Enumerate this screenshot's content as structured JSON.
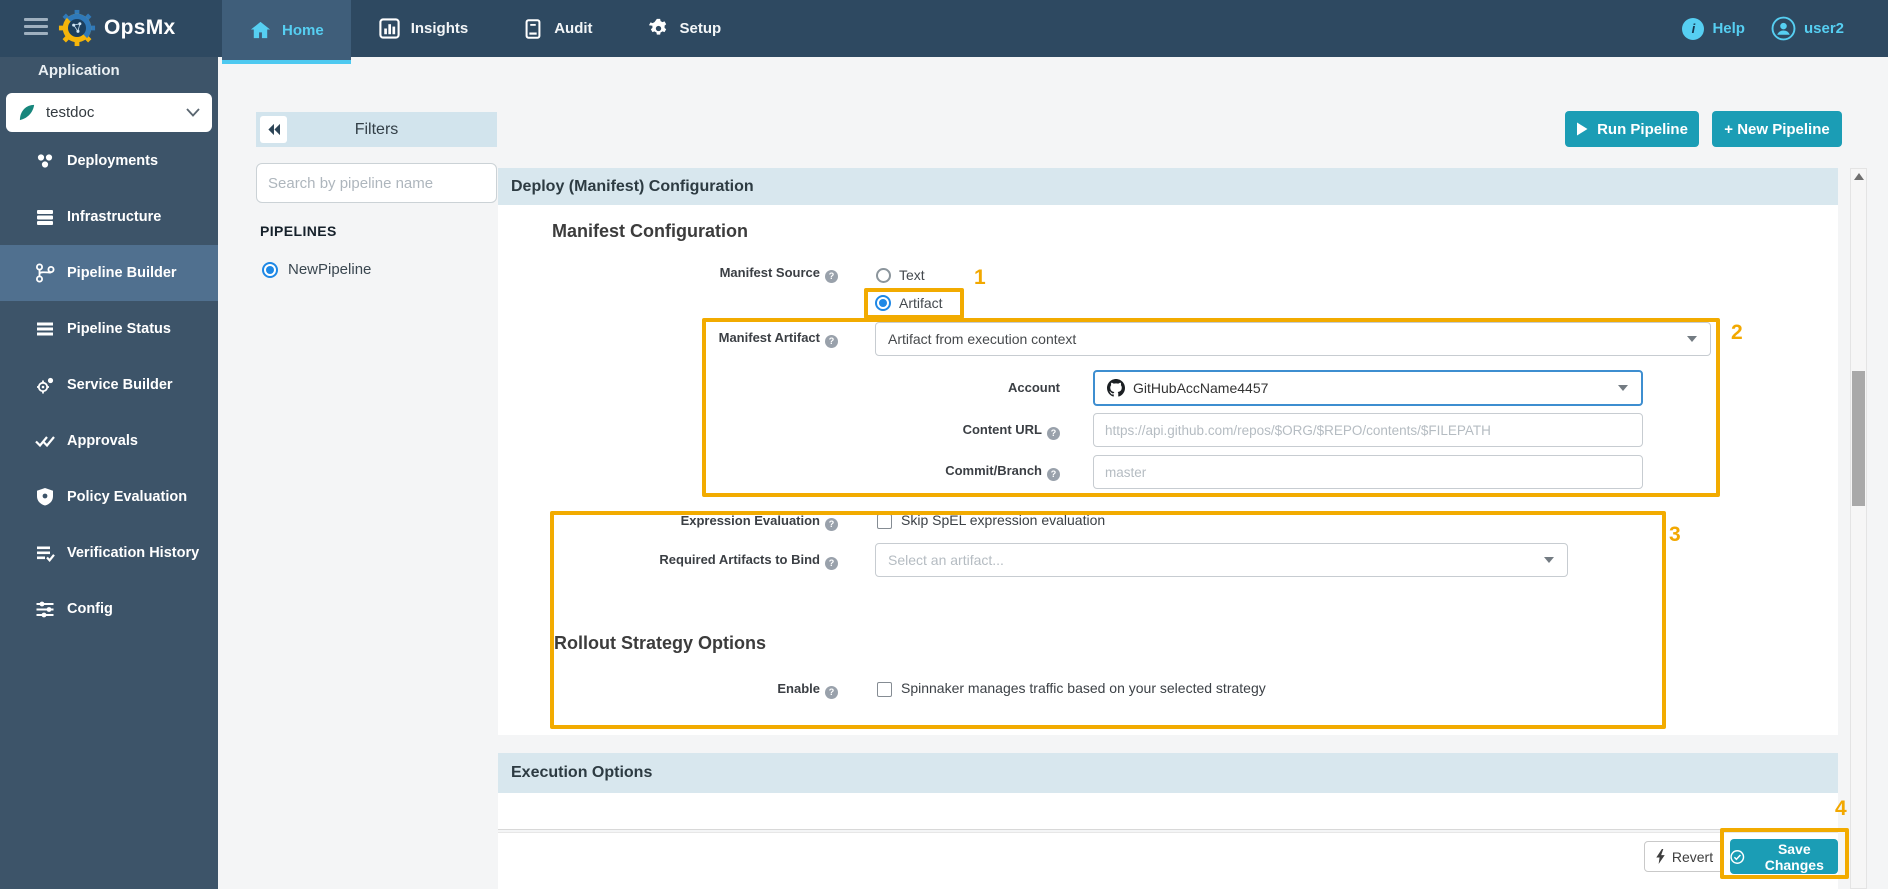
{
  "topbar": {
    "brand": "OpsMx",
    "tabs": [
      {
        "label": "Home",
        "active": true
      },
      {
        "label": "Insights",
        "active": false
      },
      {
        "label": "Audit",
        "active": false
      },
      {
        "label": "Setup",
        "active": false
      }
    ],
    "help_label": "Help",
    "user_label": "user2"
  },
  "sidebar": {
    "section_label": "Application",
    "selected_app": "testdoc",
    "items": [
      {
        "label": "Deployments"
      },
      {
        "label": "Infrastructure"
      },
      {
        "label": "Pipeline Builder",
        "active": true
      },
      {
        "label": "Pipeline Status"
      },
      {
        "label": "Service Builder"
      },
      {
        "label": "Approvals"
      },
      {
        "label": "Policy Evaluation"
      },
      {
        "label": "Verification History"
      },
      {
        "label": "Config"
      }
    ]
  },
  "filters": {
    "title": "Filters",
    "search_placeholder": "Search by pipeline name",
    "list_heading": "PIPELINES",
    "pipelines": [
      {
        "name": "NewPipeline",
        "selected": true
      }
    ]
  },
  "actions": {
    "run_pipeline": "Run Pipeline",
    "new_pipeline": "+ New Pipeline",
    "revert": "Revert",
    "save_changes": "Save Changes"
  },
  "panel": {
    "title": "Deploy (Manifest) Configuration",
    "manifest_section_title": "Manifest Configuration",
    "rollout_section_title": "Rollout Strategy Options",
    "execution_section_title": "Execution Options",
    "fields": {
      "manifest_source": {
        "label": "Manifest Source",
        "options": [
          "Text",
          "Artifact"
        ],
        "selected": "Artifact"
      },
      "manifest_artifact": {
        "label": "Manifest Artifact",
        "value": "Artifact from execution context"
      },
      "account": {
        "label": "Account",
        "value": "GitHubAccName4457"
      },
      "content_url": {
        "label": "Content URL",
        "placeholder": "https://api.github.com/repos/$ORG/$REPO/contents/$FILEPATH"
      },
      "commit_branch": {
        "label": "Commit/Branch",
        "placeholder": "master"
      },
      "expression_evaluation": {
        "label": "Expression Evaluation",
        "checkbox_label": "Skip SpEL expression evaluation",
        "checked": false
      },
      "required_artifacts": {
        "label": "Required Artifacts to Bind",
        "placeholder": "Select an artifact..."
      },
      "enable": {
        "label": "Enable",
        "checkbox_label": "Spinnaker manages traffic based on your selected strategy",
        "checked": false
      }
    }
  },
  "annotations": {
    "n1": "1",
    "n2": "2",
    "n3": "3",
    "n4": "4"
  },
  "icons": {
    "hamburger-icon": "three bars",
    "opsmx-logo": "blue/yellow gear",
    "home-icon": "house",
    "insights-icon": "bar chart",
    "audit-icon": "journal",
    "setup-icon": "gear",
    "help-icon": "info circle",
    "user-icon": "person circle",
    "app-leaf-icon": "teal sail leaf",
    "chevron-down-icon": "v",
    "collapse-icon": "double left arrows",
    "play-icon": "triangle",
    "github-icon": "octocat",
    "bolt-icon": "lightning",
    "check-circle-icon": "circled check"
  },
  "colors": {
    "teal_button": "#1b9db5",
    "cyan_accent": "#56cff2",
    "annotation_orange": "#f2a800",
    "section_header_bg": "#d8e7ee",
    "topbar_bg": "#2e4961",
    "sidebar_bg": "#3d5469",
    "radio_blue": "#1e88e5"
  }
}
